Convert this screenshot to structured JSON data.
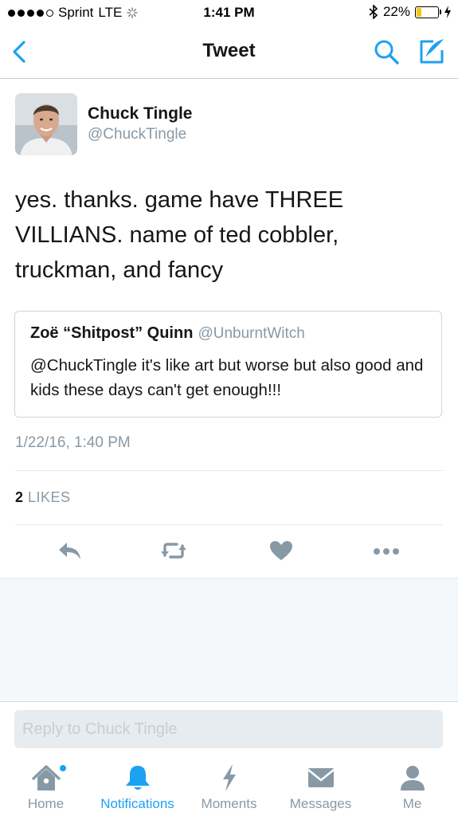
{
  "status_bar": {
    "carrier": "Sprint",
    "network": "LTE",
    "time": "1:41 PM",
    "battery_percent": "22%",
    "battery_level": 0.22,
    "signal_bars": 4
  },
  "nav": {
    "title": "Tweet",
    "back_icon": "chevron-left-icon",
    "search_icon": "search-icon",
    "compose_icon": "compose-icon"
  },
  "tweet": {
    "author_name": "Chuck Tingle",
    "author_handle": "@ChuckTingle",
    "text": "yes. thanks. game have THREE VILLIANS. name of ted cobbler, truckman, and fancy",
    "timestamp": "1/22/16, 1:40 PM",
    "likes_count": "2",
    "likes_label": "LIKES"
  },
  "quoted_tweet": {
    "author_name": "Zoë “Shitpost” Quinn",
    "author_handle": "@UnburntWitch",
    "text": "@ChuckTingle it's like art but worse but also good and kids these days can't get enough!!!"
  },
  "actions": {
    "reply_icon": "reply-icon",
    "retweet_icon": "retweet-icon",
    "like_icon": "heart-icon",
    "more_icon": "more-icon"
  },
  "reply": {
    "placeholder": "Reply to Chuck Tingle"
  },
  "tabs": [
    {
      "label": "Home",
      "icon": "home-icon",
      "active": false
    },
    {
      "label": "Notifications",
      "icon": "bell-icon",
      "active": true
    },
    {
      "label": "Moments",
      "icon": "lightning-icon",
      "active": false
    },
    {
      "label": "Messages",
      "icon": "envelope-icon",
      "active": false
    },
    {
      "label": "Me",
      "icon": "person-icon",
      "active": false
    }
  ],
  "colors": {
    "accent": "#1da1f2",
    "icon_gray": "#8899a6",
    "text": "#14171a",
    "battery": "#f5c518"
  }
}
